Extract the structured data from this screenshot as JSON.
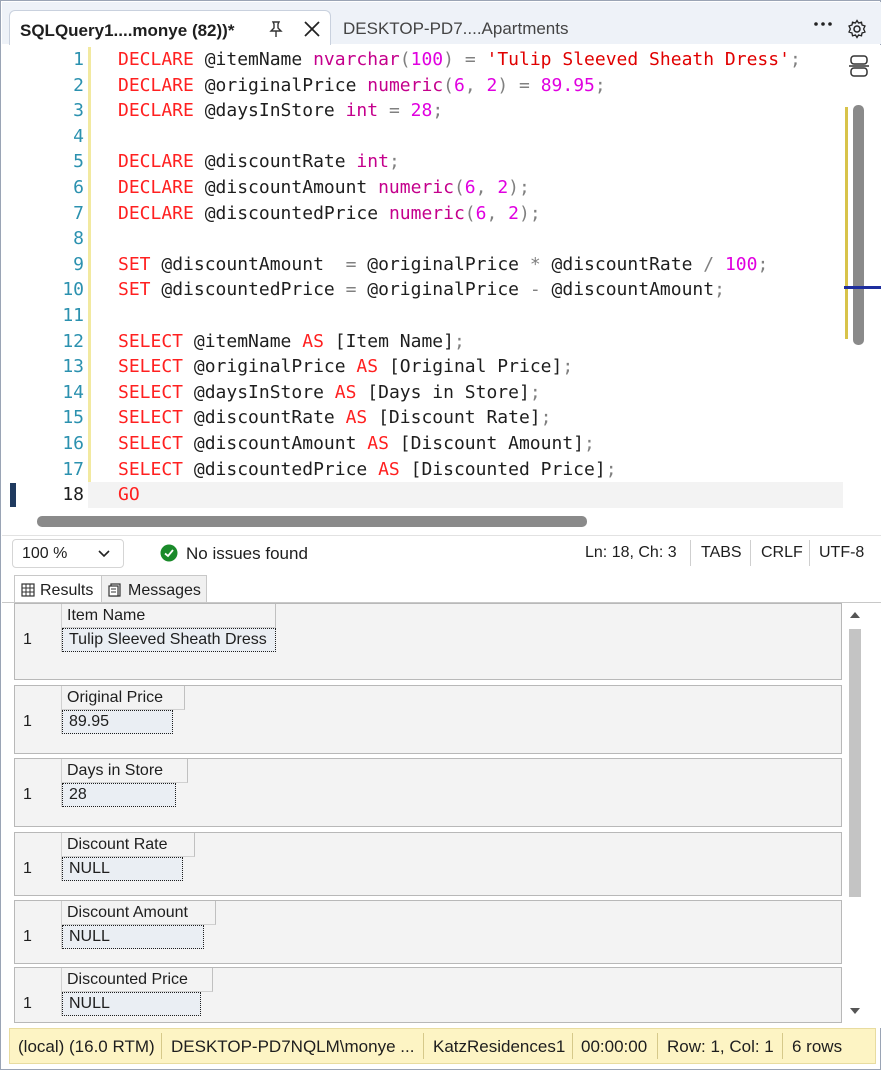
{
  "tabs": {
    "active_title": "SQLQuery1....monye (82))*",
    "inactive_title": "DESKTOP-PD7....Apartments"
  },
  "editor": {
    "line_numbers": [
      "1",
      "2",
      "3",
      "4",
      "5",
      "6",
      "7",
      "8",
      "9",
      "10",
      "11",
      "12",
      "13",
      "14",
      "15",
      "16",
      "17",
      "18"
    ],
    "current_line": "18",
    "code_lines": [
      [
        {
          "t": "DECLARE ",
          "c": "kw"
        },
        {
          "t": "@itemName ",
          "c": "id"
        },
        {
          "t": "nvarchar",
          "c": "kw2"
        },
        {
          "t": "(",
          "c": "gray"
        },
        {
          "t": "100",
          "c": "num"
        },
        {
          "t": ") = ",
          "c": "gray"
        },
        {
          "t": "'Tulip Sleeved Sheath Dress'",
          "c": "str"
        },
        {
          "t": ";",
          "c": "gray"
        }
      ],
      [
        {
          "t": "DECLARE ",
          "c": "kw"
        },
        {
          "t": "@originalPrice ",
          "c": "id"
        },
        {
          "t": "numeric",
          "c": "kw2"
        },
        {
          "t": "(",
          "c": "gray"
        },
        {
          "t": "6",
          "c": "num"
        },
        {
          "t": ", ",
          "c": "gray"
        },
        {
          "t": "2",
          "c": "num"
        },
        {
          "t": ") = ",
          "c": "gray"
        },
        {
          "t": "89.95",
          "c": "num"
        },
        {
          "t": ";",
          "c": "gray"
        }
      ],
      [
        {
          "t": "DECLARE ",
          "c": "kw"
        },
        {
          "t": "@daysInStore ",
          "c": "id"
        },
        {
          "t": "int",
          "c": "kw2"
        },
        {
          "t": " = ",
          "c": "gray"
        },
        {
          "t": "28",
          "c": "num"
        },
        {
          "t": ";",
          "c": "gray"
        }
      ],
      [],
      [
        {
          "t": "DECLARE ",
          "c": "kw"
        },
        {
          "t": "@discountRate ",
          "c": "id"
        },
        {
          "t": "int",
          "c": "kw2"
        },
        {
          "t": ";",
          "c": "gray"
        }
      ],
      [
        {
          "t": "DECLARE ",
          "c": "kw"
        },
        {
          "t": "@discountAmount ",
          "c": "id"
        },
        {
          "t": "numeric",
          "c": "kw2"
        },
        {
          "t": "(",
          "c": "gray"
        },
        {
          "t": "6",
          "c": "num"
        },
        {
          "t": ", ",
          "c": "gray"
        },
        {
          "t": "2",
          "c": "num"
        },
        {
          "t": ");",
          "c": "gray"
        }
      ],
      [
        {
          "t": "DECLARE ",
          "c": "kw"
        },
        {
          "t": "@discountedPrice ",
          "c": "id"
        },
        {
          "t": "numeric",
          "c": "kw2"
        },
        {
          "t": "(",
          "c": "gray"
        },
        {
          "t": "6",
          "c": "num"
        },
        {
          "t": ", ",
          "c": "gray"
        },
        {
          "t": "2",
          "c": "num"
        },
        {
          "t": ");",
          "c": "gray"
        }
      ],
      [],
      [
        {
          "t": "SET ",
          "c": "kw"
        },
        {
          "t": "@discountAmount  ",
          "c": "id"
        },
        {
          "t": "= ",
          "c": "gray"
        },
        {
          "t": "@originalPrice ",
          "c": "id"
        },
        {
          "t": "* ",
          "c": "gray"
        },
        {
          "t": "@discountRate ",
          "c": "id"
        },
        {
          "t": "/ ",
          "c": "gray"
        },
        {
          "t": "100",
          "c": "num"
        },
        {
          "t": ";",
          "c": "gray"
        }
      ],
      [
        {
          "t": "SET ",
          "c": "kw"
        },
        {
          "t": "@discountedPrice ",
          "c": "id"
        },
        {
          "t": "= ",
          "c": "gray"
        },
        {
          "t": "@originalPrice ",
          "c": "id"
        },
        {
          "t": "- ",
          "c": "gray"
        },
        {
          "t": "@discountAmount",
          "c": "id"
        },
        {
          "t": ";",
          "c": "gray"
        }
      ],
      [],
      [
        {
          "t": "SELECT ",
          "c": "kw"
        },
        {
          "t": "@itemName ",
          "c": "id"
        },
        {
          "t": "AS ",
          "c": "kw"
        },
        {
          "t": "[Item Name]",
          "c": "id"
        },
        {
          "t": ";",
          "c": "gray"
        }
      ],
      [
        {
          "t": "SELECT ",
          "c": "kw"
        },
        {
          "t": "@originalPrice ",
          "c": "id"
        },
        {
          "t": "AS ",
          "c": "kw"
        },
        {
          "t": "[Original Price]",
          "c": "id"
        },
        {
          "t": ";",
          "c": "gray"
        }
      ],
      [
        {
          "t": "SELECT ",
          "c": "kw"
        },
        {
          "t": "@daysInStore ",
          "c": "id"
        },
        {
          "t": "AS ",
          "c": "kw"
        },
        {
          "t": "[Days in Store]",
          "c": "id"
        },
        {
          "t": ";",
          "c": "gray"
        }
      ],
      [
        {
          "t": "SELECT ",
          "c": "kw"
        },
        {
          "t": "@discountRate ",
          "c": "id"
        },
        {
          "t": "AS ",
          "c": "kw"
        },
        {
          "t": "[Discount Rate]",
          "c": "id"
        },
        {
          "t": ";",
          "c": "gray"
        }
      ],
      [
        {
          "t": "SELECT ",
          "c": "kw"
        },
        {
          "t": "@discountAmount ",
          "c": "id"
        },
        {
          "t": "AS ",
          "c": "kw"
        },
        {
          "t": "[Discount Amount]",
          "c": "id"
        },
        {
          "t": ";",
          "c": "gray"
        }
      ],
      [
        {
          "t": "SELECT ",
          "c": "kw"
        },
        {
          "t": "@discountedPrice ",
          "c": "id"
        },
        {
          "t": "AS ",
          "c": "kw"
        },
        {
          "t": "[Discounted Price]",
          "c": "id"
        },
        {
          "t": ";",
          "c": "gray"
        }
      ],
      [
        {
          "t": "GO",
          "c": "kw"
        }
      ]
    ]
  },
  "editor_status": {
    "zoom": "100 %",
    "issues": "No issues found",
    "position": "Ln: 18, Ch: 3",
    "indent": "TABS",
    "line_ending": "CRLF",
    "encoding": "UTF-8"
  },
  "result_tabs": {
    "results": "Results",
    "messages": "Messages"
  },
  "results": [
    {
      "column": "Item Name",
      "row": "1",
      "value": "Tulip Sleeved Sheath Dress"
    },
    {
      "column": "Original Price",
      "row": "1",
      "value": "89.95"
    },
    {
      "column": "Days in Store",
      "row": "1",
      "value": "28"
    },
    {
      "column": "Discount Rate",
      "row": "1",
      "value": "NULL"
    },
    {
      "column": "Discount Amount",
      "row": "1",
      "value": "NULL"
    },
    {
      "column": "Discounted Price",
      "row": "1",
      "value": "NULL"
    }
  ],
  "statusbar": {
    "server": "(local) (16.0 RTM)",
    "user": "DESKTOP-PD7NQLM\\monye ...",
    "database": "KatzResidences1",
    "elapsed": "00:00:00",
    "rowcol": "Row: 1, Col: 1",
    "rows": "6 rows"
  },
  "colors": {
    "keyword": "#ff2020",
    "type": "#c4008c",
    "number": "#e000e0",
    "line_number": "#2b91af",
    "statusbar_bg": "#fdf4c4",
    "ok_green": "#1a8a2a"
  }
}
